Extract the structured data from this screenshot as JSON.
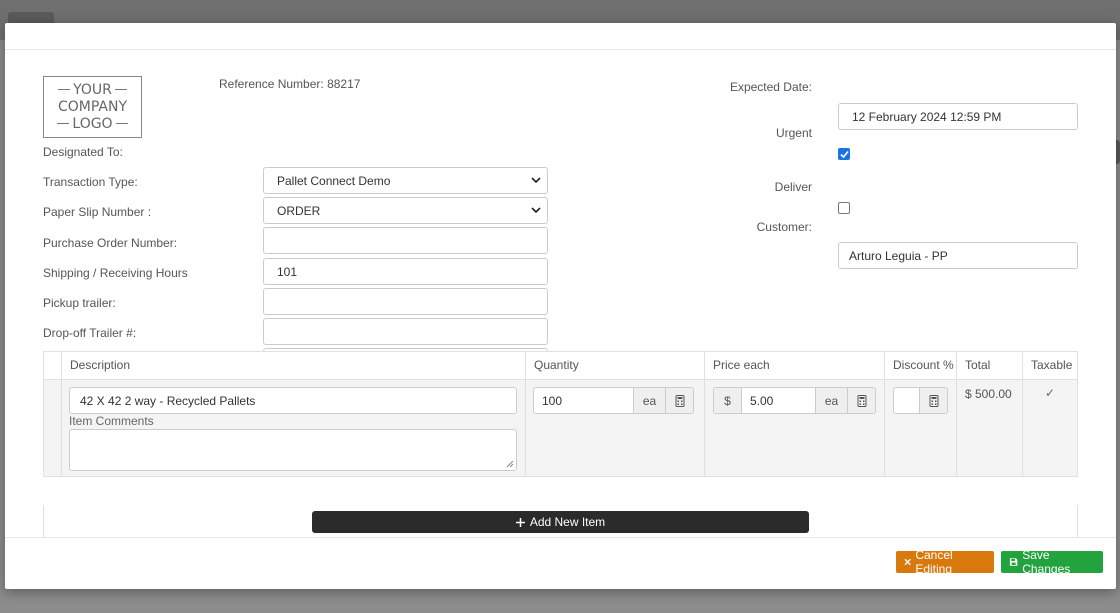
{
  "logo": {
    "line1": "YOUR",
    "line2": "COMPANY",
    "line3": "LOGO"
  },
  "reference": {
    "label": "Reference Number:",
    "value": "88217"
  },
  "fields": {
    "designated_to": {
      "label": "Designated To:",
      "value": "Pallet Connect Demo"
    },
    "transaction_type": {
      "label": "Transaction Type:",
      "value": "ORDER"
    },
    "paper_slip": {
      "label": "Paper Slip Number :",
      "value": ""
    },
    "purchase_order": {
      "label": "Purchase Order Number:",
      "value": "101"
    },
    "shipping_hours": {
      "label": "Shipping / Receiving Hours",
      "value": ""
    },
    "pickup_trailer": {
      "label": "Pickup trailer:",
      "value": ""
    },
    "dropoff_trailer": {
      "label": "Drop-off Trailer #:",
      "value": ""
    },
    "expected_date": {
      "label": "Expected Date:",
      "value": "12 February 2024 12:59 PM"
    },
    "urgent": {
      "label": "Urgent",
      "checked": true
    },
    "deliver": {
      "label": "Deliver",
      "checked": false
    },
    "customer": {
      "label": "Customer:",
      "value": "Arturo Leguia - PP"
    }
  },
  "table": {
    "headers": [
      "Description",
      "Quantity",
      "Price each",
      "Discount %",
      "Total",
      "Taxable"
    ],
    "rows": [
      {
        "description": "42 X 42 2 way - Recycled Pallets",
        "comments_label": "Item Comments",
        "comments": "",
        "quantity": "100",
        "unit": "ea",
        "currency": "$",
        "price": "5.00",
        "price_unit": "ea",
        "discount": "",
        "total": "$ 500.00",
        "taxable": "✓"
      }
    ]
  },
  "buttons": {
    "add_item": "Add New Item",
    "cancel": "Cancel Editing",
    "save": "Save Changes"
  },
  "colors": {
    "cancel": "#d9780c",
    "save": "#22a33d",
    "add_item": "#2b2b2b",
    "checkbox_on": "#1a73e8"
  }
}
